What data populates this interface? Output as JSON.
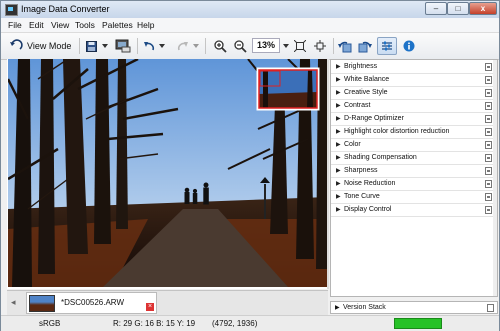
{
  "window": {
    "title": "Image Data Converter",
    "controls": {
      "minimize": "–",
      "maximize": "□",
      "close": "x"
    }
  },
  "menu": [
    "File",
    "Edit",
    "View",
    "Tools",
    "Palettes",
    "Help"
  ],
  "toolbar": {
    "view_mode_label": "View Mode",
    "zoom_value": "13%"
  },
  "palette": {
    "items": [
      "Brightness",
      "White Balance",
      "Creative Style",
      "Contrast",
      "D-Range Optimizer",
      "Highlight color distortion reduction",
      "Color",
      "Shading Compensation",
      "Sharpness",
      "Noise Reduction",
      "Tone Curve",
      "Display Control"
    ],
    "version_stack_label": "Version Stack"
  },
  "filmstrip": {
    "file_name": "*DSC00526.ARW"
  },
  "statusbar": {
    "color_space": "sRGB",
    "pixel_readout": "R: 29  G: 16  B: 15  Y: 19",
    "coordinates": "(4792, 1936)"
  },
  "colors": {
    "accent_blue": "#1e73c8",
    "close_red": "#c4402a",
    "navigator_red": "#e02020",
    "progress_green": "#27c227"
  }
}
